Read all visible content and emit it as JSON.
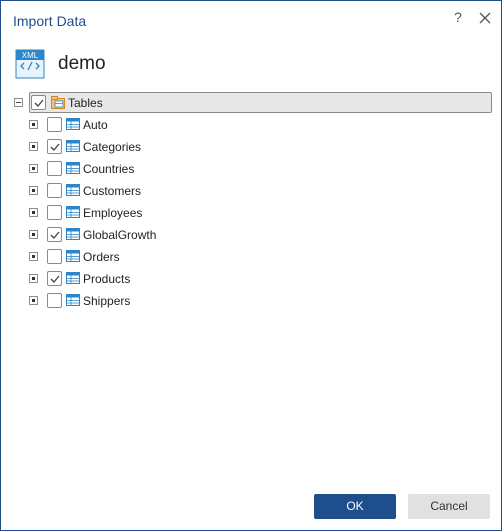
{
  "dialog": {
    "title": "Import Data",
    "help_label": "?",
    "file_name": "demo",
    "file_icon_text": "XML",
    "root": {
      "label": "Tables",
      "checked": true
    },
    "items": [
      {
        "label": "Auto",
        "checked": false
      },
      {
        "label": "Categories",
        "checked": true
      },
      {
        "label": "Countries",
        "checked": false
      },
      {
        "label": "Customers",
        "checked": false
      },
      {
        "label": "Employees",
        "checked": false
      },
      {
        "label": "GlobalGrowth",
        "checked": true
      },
      {
        "label": "Orders",
        "checked": false
      },
      {
        "label": "Products",
        "checked": true
      },
      {
        "label": "Shippers",
        "checked": false
      }
    ],
    "ok_label": "OK",
    "cancel_label": "Cancel"
  },
  "colors": {
    "accent": "#1e4f8c",
    "icon_blue": "#2c86c7",
    "folder": "#e8a33a"
  }
}
